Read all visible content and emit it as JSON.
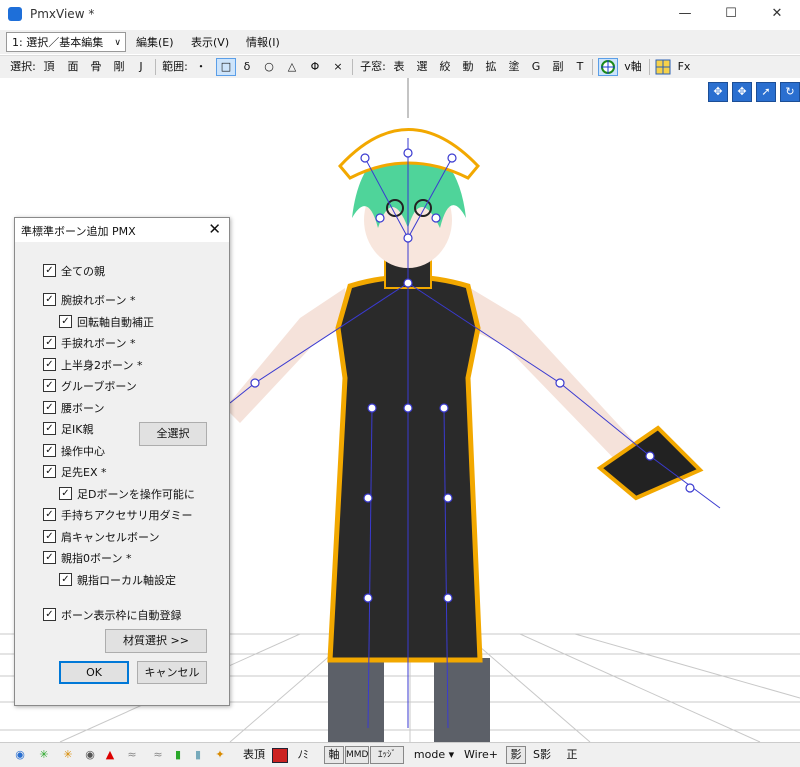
{
  "window": {
    "title": "PmxView *"
  },
  "menu": {
    "mode_select": "1: 選択／基本編集",
    "items": [
      "編集(E)",
      "表示(V)",
      "情報(I)"
    ]
  },
  "toolbar": {
    "select_label": "選択:",
    "select_items": [
      "頂",
      "面",
      "骨",
      "剛",
      "J"
    ],
    "range_label": "範囲:",
    "range_items": [
      "・",
      "δ",
      "○",
      "△",
      "Φ",
      "×"
    ],
    "child_window_label": "子窓:",
    "child_window_items": [
      "表",
      "選",
      "絞",
      "動",
      "拡",
      "塗",
      "G",
      "副",
      "T"
    ],
    "axis_label": "v軸",
    "fx_label": "Fx"
  },
  "dialog": {
    "title": "準標準ボーン追加 PMX",
    "checkboxes": [
      "全ての親",
      "腕捩れボーン *",
      "回転軸自動補正",
      "手捩れボーン *",
      "上半身2ボーン *",
      "グルーブボーン",
      "腰ボーン",
      "足IK親",
      "操作中心",
      "足先EX *",
      "足Dボーンを操作可能に",
      "手持ちアクセサリ用ダミー",
      "肩キャンセルボーン",
      "親指0ボーン *",
      "親指ローカル軸設定",
      "ボーン表示枠に自動登録"
    ],
    "select_all": "全選択",
    "material_select": "材質選択 >>",
    "ok": "OK",
    "cancel": "キャンセル"
  },
  "statusbar": {
    "table_vertex": "表頂",
    "mirror": "ﾉﾐ",
    "axis": "軸",
    "md": "MMD",
    "edge": "ｴｯｼﾞ",
    "mode": "mode ▾",
    "wire": "Wire+",
    "shadow": "影",
    "s_shadow": "S影",
    "front": "正"
  }
}
